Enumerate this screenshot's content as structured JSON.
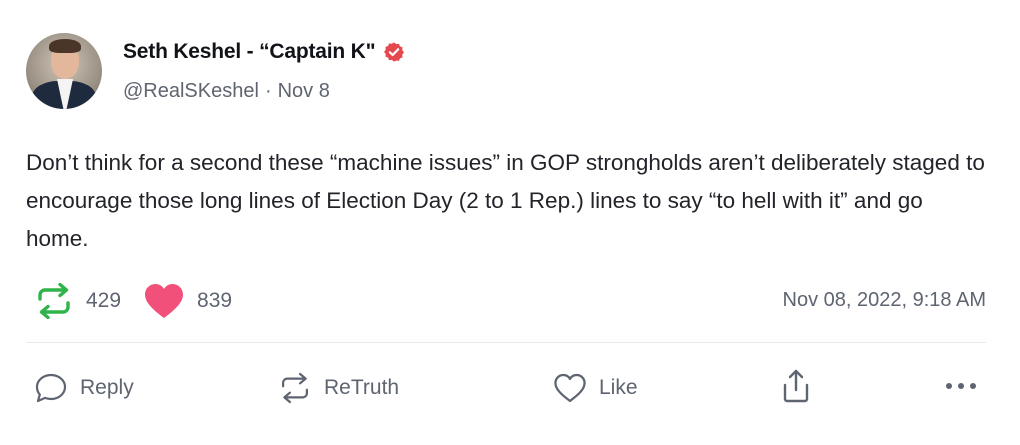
{
  "author": {
    "display_name": "Seth Keshel - “Captain K\"",
    "handle": "@RealSKeshel",
    "separator": "·",
    "relative_date": "Nov 8",
    "verified_badge_color": "#e5484d"
  },
  "post": {
    "text": "Don’t think for a second these “machine issues” in GOP strongholds aren’t deliberately staged to encourage those long lines of Election Day (2 to 1 Rep.) lines to say “to hell with it” and go home.",
    "retruth_count": "429",
    "like_count": "839",
    "timestamp": "Nov 08, 2022, 9:18 AM"
  },
  "icons": {
    "retruth_stat": "retruth-icon",
    "like_stat": "heart-filled-icon",
    "reply": "speech-bubble-icon",
    "retruth": "retruth-icon",
    "like": "heart-outline-icon",
    "share": "share-icon",
    "more": "ellipsis-icon"
  },
  "colors": {
    "retruth_green": "#2fb34a",
    "heart_pink": "#f0507a",
    "muted": "#5e6470"
  },
  "actions": {
    "reply_label": "Reply",
    "retruth_label": "ReTruth",
    "like_label": "Like"
  }
}
